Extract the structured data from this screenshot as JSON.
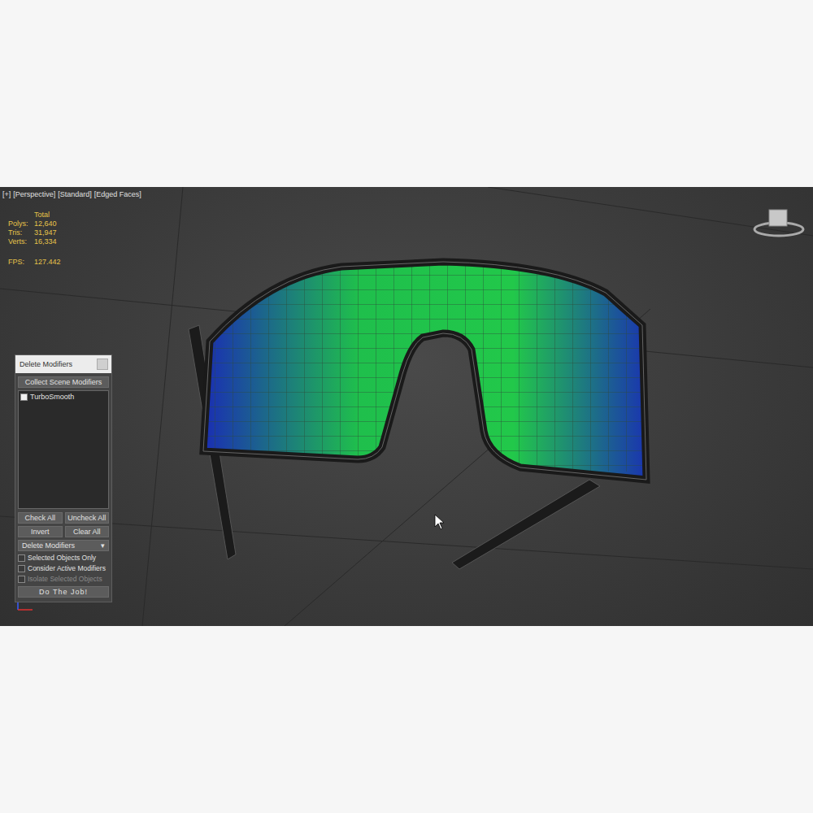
{
  "viewport": {
    "labels": [
      "[+]",
      "[Perspective]",
      "[Standard]",
      "[Edged Faces]"
    ],
    "stats": {
      "header": "Total",
      "rows": [
        {
          "label": "Polys:",
          "value": "12,640"
        },
        {
          "label": "Tris:",
          "value": "31,947"
        },
        {
          "label": "Verts:",
          "value": "16,334"
        }
      ]
    },
    "fps": {
      "label": "FPS:",
      "value": "127.442"
    }
  },
  "panel": {
    "title": "Delete Modifiers",
    "collect_button": "Collect Scene Modifiers",
    "modifiers": [
      {
        "name": "TurboSmooth",
        "checked": false
      }
    ],
    "buttons": [
      "Check All",
      "Uncheck All",
      "Invert",
      "Clear All"
    ],
    "mode_dropdown": {
      "value": "Delete Modifiers",
      "arrow": "▾"
    },
    "options": [
      {
        "label": "Selected Objects Only",
        "checked": false,
        "disabled": false
      },
      {
        "label": "Consider Active Modifiers",
        "checked": false,
        "disabled": false
      },
      {
        "label": "Isolate Selected Objects",
        "checked": false,
        "disabled": true
      }
    ],
    "run_button": "Do The Job!"
  }
}
